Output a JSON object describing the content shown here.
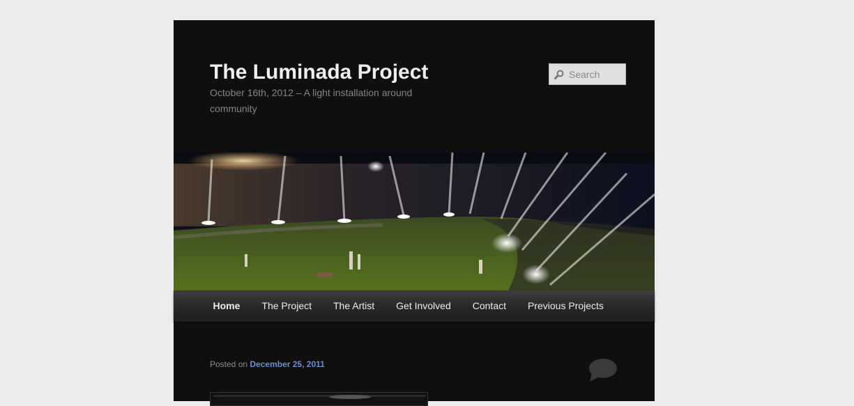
{
  "site": {
    "title": "The Luminada Project",
    "description": "October 16th, 2012 – A light installation around community"
  },
  "search": {
    "placeholder": "Search",
    "icon": "search-icon"
  },
  "banner": {
    "icon": "banner-photo"
  },
  "nav": {
    "items": [
      {
        "label": "Home",
        "current": true
      },
      {
        "label": "The Project"
      },
      {
        "label": "The Artist"
      },
      {
        "label": "Get Involved"
      },
      {
        "label": "Contact"
      },
      {
        "label": "Previous Projects"
      }
    ]
  },
  "post": {
    "posted_on_label": "Posted on",
    "date": "December 25, 2011",
    "comment_icon": "comment-bubble-icon"
  },
  "colors": {
    "page_bg": "#ebebeb",
    "content_bg": "#0f0f0f",
    "link": "#6c8dcf"
  }
}
